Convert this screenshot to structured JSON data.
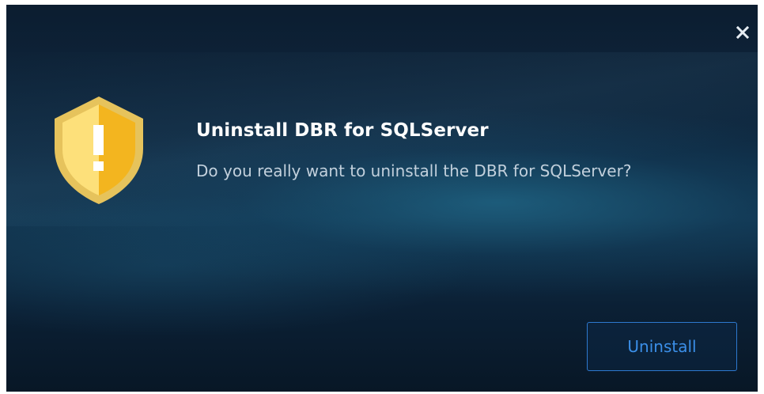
{
  "dialog": {
    "title": "Uninstall DBR for SQLServer",
    "message": "Do you really want to uninstall the DBR for SQLServer?",
    "uninstall_label": "Uninstall",
    "close_icon": "close-icon",
    "warning_icon": "shield-warning-icon"
  },
  "colors": {
    "background": "#0f2a42",
    "shield": "#f5c12e",
    "button_border": "#2d79cf",
    "button_text": "#3b8fe8"
  }
}
